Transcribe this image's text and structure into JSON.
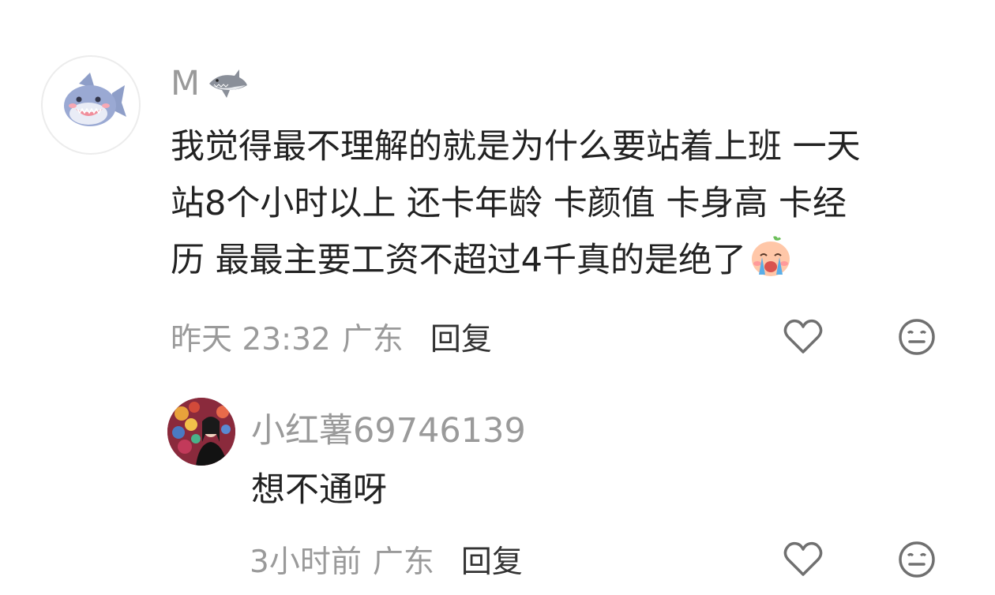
{
  "comment": {
    "username": "M",
    "name_emoji": "shark-emoji",
    "lines": [
      "我觉得最不理解的就是为什么要站着上班 一天",
      "站8个小时以上 还卡年龄 卡颜值 卡身高 卡经",
      "历 最最主要工资不超过4千真的是绝了"
    ],
    "inline_emoji": "crying-emoji",
    "time": "昨天 23:32",
    "location": "广东",
    "reply_label": "回复",
    "like_icon": "heart-outline-icon",
    "react_icon": "neutral-face-icon"
  },
  "reply": {
    "username": "小红薯69746139",
    "text": "想不通呀",
    "time": "3小时前",
    "location": "广东",
    "reply_label": "回复",
    "like_icon": "heart-outline-icon",
    "react_icon": "neutral-face-icon"
  },
  "colors": {
    "meta_text": "#9a9a9a",
    "body_text": "#222222",
    "reply_label": "#333333",
    "icon_stroke": "#707070"
  }
}
